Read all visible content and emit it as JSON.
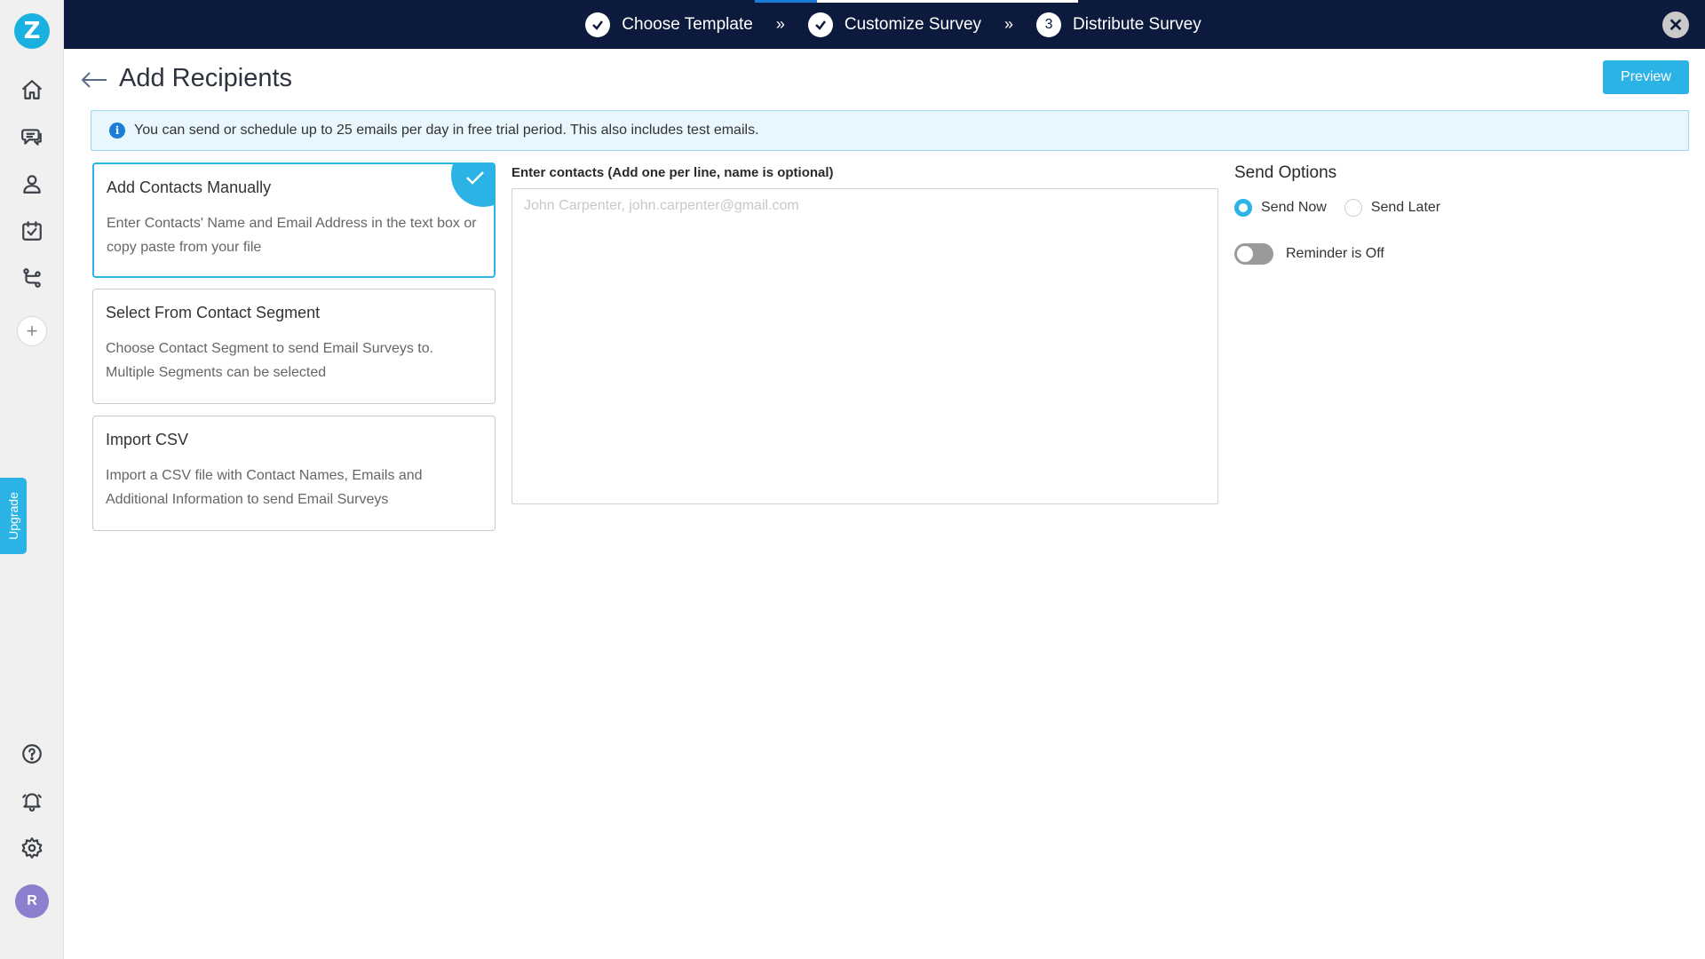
{
  "sidebar": {
    "logo_text": "Z",
    "nav_icons": [
      "home-icon",
      "surveys-icon",
      "contacts-icon",
      "calendar-check-icon",
      "workflow-icon"
    ],
    "add_icon_text": "+",
    "upgrade_label": "Upgrade",
    "bottom_icons": [
      "help-icon",
      "notification-bell-icon",
      "gear-icon"
    ],
    "avatar_initial": "R"
  },
  "topbar": {
    "steps": [
      {
        "label": "Choose Template",
        "state": "done"
      },
      {
        "label": "Customize Survey",
        "state": "done"
      },
      {
        "number": "3",
        "label": "Distribute Survey",
        "state": "current"
      }
    ],
    "separator": "»",
    "close_symbol": "✕"
  },
  "header": {
    "title": "Add Recipients",
    "preview_label": "Preview"
  },
  "info_banner": {
    "icon_text": "i",
    "text": "You can send or schedule up to 25 emails per day in free trial period. This also includes test emails."
  },
  "options": [
    {
      "title": "Add Contacts Manually",
      "description": "Enter Contacts' Name and Email Address in the text box or copy paste from your file",
      "selected": true
    },
    {
      "title": "Select From Contact Segment",
      "description": "Choose Contact Segment to send Email Surveys to. Multiple Segments can be selected",
      "selected": false
    },
    {
      "title": "Import CSV",
      "description": "Import a CSV file with Contact Names, Emails and Additional Information to send Email Surveys",
      "selected": false
    }
  ],
  "contacts": {
    "label": "Enter contacts (Add one per line, name is optional)",
    "placeholder": "John Carpenter, john.carpenter@gmail.com",
    "value": ""
  },
  "send_options": {
    "title": "Send Options",
    "send_now": "Send Now",
    "send_later": "Send Later",
    "selected": "Send Now",
    "reminder_label": "Reminder is Off",
    "reminder_on": false
  },
  "colors": {
    "accent": "#2bb3e6",
    "topbar_bg": "#0c1a3e",
    "info_bg": "#e8f6fd"
  }
}
